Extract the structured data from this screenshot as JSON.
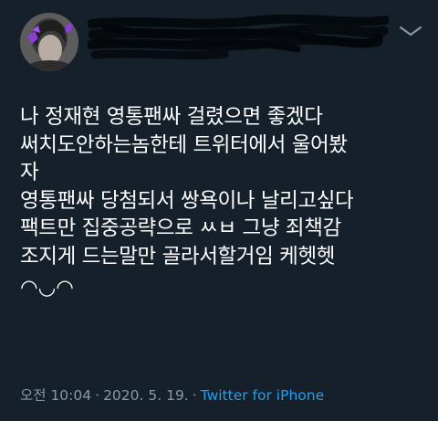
{
  "tweet": {
    "lines": [
      "나 정재현 영통팬싸 걸렸으면 좋겠다",
      "써치도안하는놈한테 트위터에서 울어봤",
      "자",
      "영통팬싸 당첨되서 쌍욕이나 날리고싶다",
      "팩트만 집중공략으로 ㅆㅂ 그냥 죄책감",
      "조지게 드는말만 골라서할거임 케헷헷"
    ],
    "emoticon": "◠◡◠"
  },
  "meta": {
    "time": "오전 10:04",
    "date": "2020. 5. 19.",
    "dot": "·",
    "source": "Twitter for iPhone"
  },
  "icons": {
    "more": "more-options-icon",
    "avatar": "profile-avatar"
  },
  "colors": {
    "background": "#15202b",
    "text": "#ffffff",
    "muted": "#8899a6",
    "link": "#1da1f2"
  }
}
